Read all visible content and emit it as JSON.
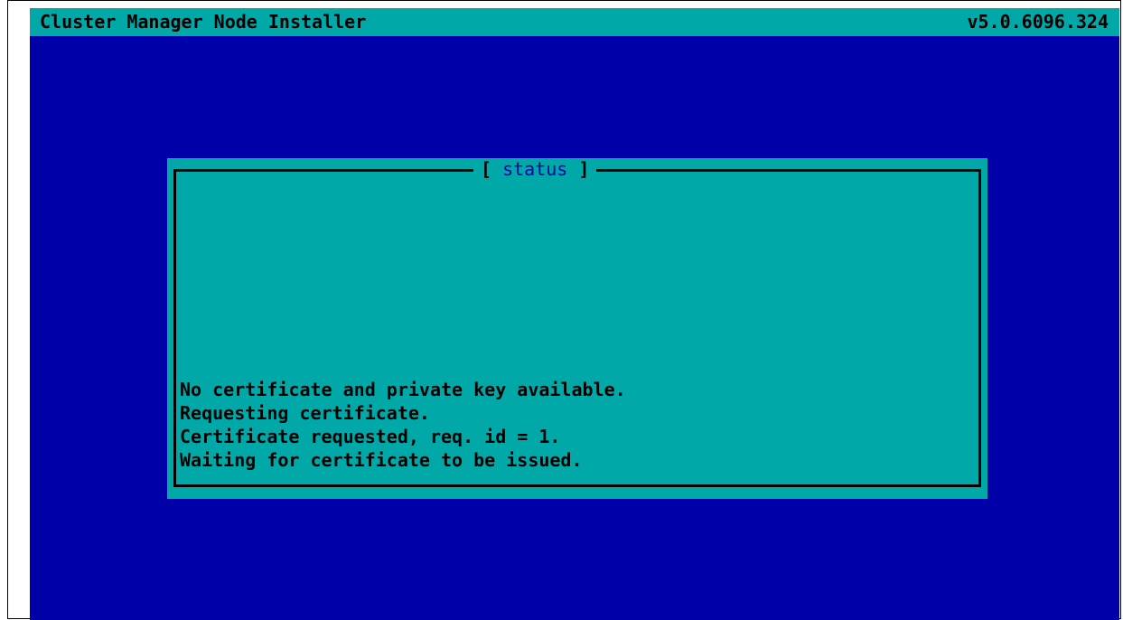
{
  "header": {
    "title": "Cluster Manager Node Installer",
    "version": "v5.0.6096.324"
  },
  "dialog": {
    "bracket_open": "[",
    "title": "status",
    "bracket_close": "]",
    "lines": [
      "No certificate and private key available.",
      "Requesting certificate.",
      "Certificate requested, req. id = 1.",
      "Waiting for certificate to be issued."
    ]
  },
  "colors": {
    "background": "#0000a8",
    "accent": "#00a8a8",
    "text": "#000000"
  }
}
